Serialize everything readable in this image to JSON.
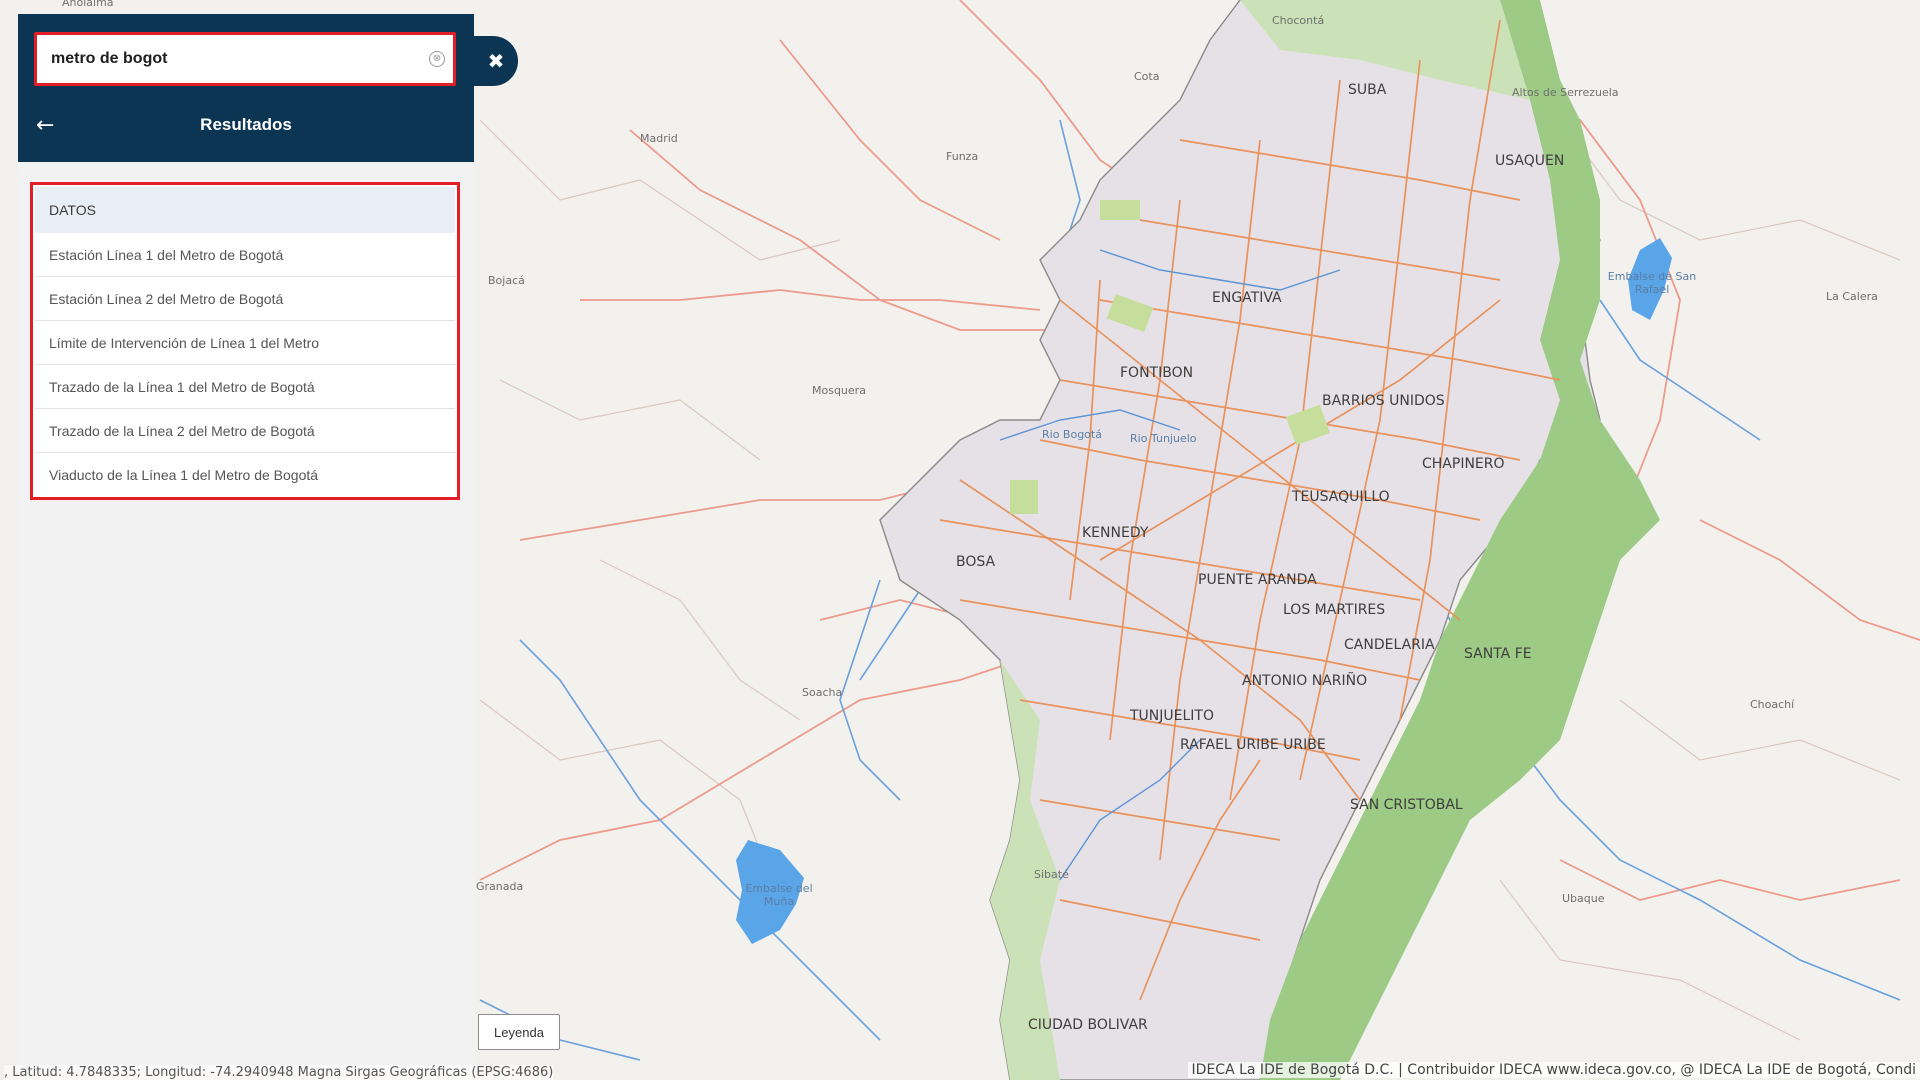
{
  "search": {
    "value": "metro de bogot",
    "clear_icon": "⊗",
    "close_icon": "✖"
  },
  "header": {
    "back_icon": "←",
    "title": "Resultados"
  },
  "results": {
    "section_label": "DATOS",
    "items": [
      "Estación Línea 1 del Metro de Bogotá",
      "Estación Línea 2 del Metro de Bogotá",
      "Límite de Intervención de Línea 1 del Metro",
      "Trazado de la Línea 1 del Metro de Bogotá",
      "Trazado de la Línea 2 del Metro de Bogotá",
      "Viaducto de la Línea 1 del Metro de Bogotá"
    ]
  },
  "legend_label": "Leyenda",
  "coordinates_text": ", Latitud: 4.7848335; Longitud: -74.2940948 Magna Sirgas Geográficas (EPSG:4686)",
  "attribution_text": "IDECA La IDE de Bogotá D.C. | Contribuidor IDECA www.ideca.gov.co, @ IDECA La IDE de Bogotá, Condi",
  "map": {
    "colors": {
      "header": "#0b3553",
      "highlight": "#e31e26",
      "city_fill": "#e6e1e6",
      "forest": "#9dcb85",
      "roads": "#e9925c",
      "rivers": "#5a93d8"
    },
    "localities": [
      "SUBA",
      "USAQUEN",
      "ENGATIVA",
      "FONTIBON",
      "BARRIOS UNIDOS",
      "CHAPINERO",
      "TEUSAQUILLO",
      "KENNEDY",
      "BOSA",
      "PUENTE ARANDA",
      "LOS MARTIRES",
      "CANDELARIA",
      "SANTA FE",
      "ANTONIO NARIÑO",
      "TUNJUELITO",
      "RAFAEL URIBE URIBE",
      "SAN CRISTOBAL",
      "CIUDAD BOLIVAR"
    ],
    "towns": [
      "Anolaima",
      "Chocontá",
      "Cota",
      "Funza",
      "Madrid",
      "Bojacá",
      "Mosquera",
      "Soacha",
      "Granada",
      "Sibaté",
      "La Calera",
      "Choachí",
      "Ubaque",
      "Altos de Serrezuela"
    ],
    "water_labels": [
      "Embalse de San Rafael",
      "Embalse del Muña",
      "Rio Bogotá",
      "Rio Tunjuelo"
    ]
  }
}
